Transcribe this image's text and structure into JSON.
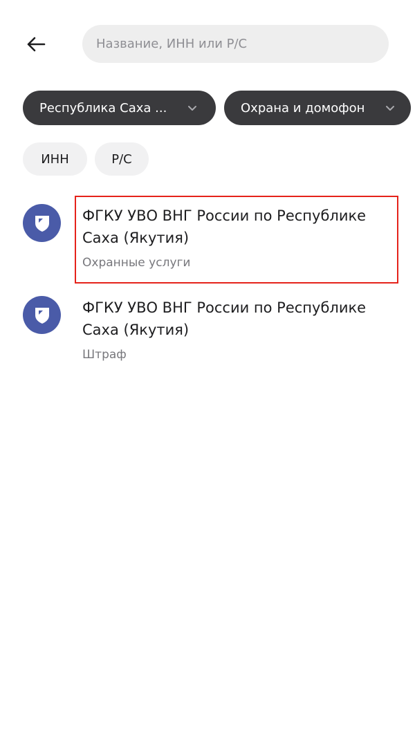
{
  "header": {
    "back_icon": "arrow-left-icon",
    "search_placeholder": "Название, ИНН или Р/С",
    "search_value": ""
  },
  "filters": [
    {
      "label": "Республика Саха ...",
      "icon": "chevron-down-icon"
    },
    {
      "label": "Охрана и домофон",
      "icon": "chevron-down-icon"
    }
  ],
  "search_type_chips": [
    {
      "label": "ИНН"
    },
    {
      "label": "Р/С"
    }
  ],
  "results": [
    {
      "title": "ФГКУ УВО ВНГ России по Республике Саха (Якутия)",
      "subtitle": "Охранные услуги",
      "icon": "shield-icon",
      "highlighted": true
    },
    {
      "title": "ФГКУ УВО ВНГ России по Республике Саха (Якутия)",
      "subtitle": "Штраф",
      "icon": "shield-icon",
      "highlighted": false
    }
  ],
  "colors": {
    "dark_chip": "#3a3a3d",
    "light_chip": "#f1f1f2",
    "avatar": "#4a5ba8",
    "highlight_border": "#e5221a"
  }
}
